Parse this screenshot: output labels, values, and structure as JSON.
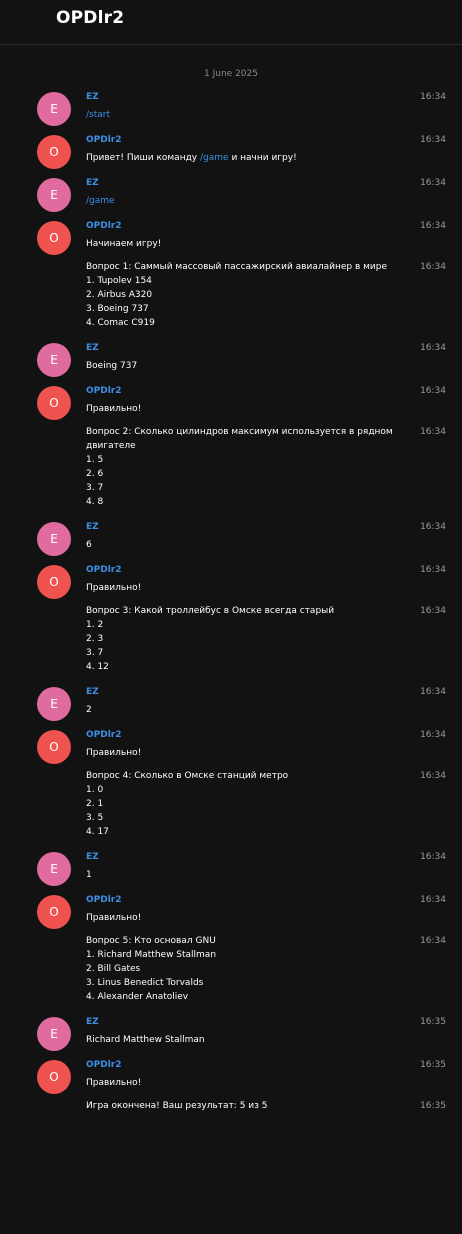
{
  "header": {
    "title": "OPDlr2"
  },
  "date_separator": "1 June 2025",
  "messages": [
    {
      "sender": "EZ",
      "avatar": "E",
      "time": "16:34",
      "lines": [
        {
          "parts": [
            {
              "t": "/start",
              "link": true
            }
          ],
          "time": ""
        }
      ]
    },
    {
      "sender": "OPDlr2",
      "avatar": "O",
      "time": "16:34",
      "lines": [
        {
          "parts": [
            {
              "t": "Привет! Пиши команду "
            },
            {
              "t": "/game",
              "link": true
            },
            {
              "t": " и начни игру!"
            }
          ],
          "time": ""
        }
      ]
    },
    {
      "sender": "EZ",
      "avatar": "E",
      "time": "16:34",
      "lines": [
        {
          "parts": [
            {
              "t": "/game",
              "link": true
            }
          ],
          "time": ""
        }
      ]
    },
    {
      "sender": "OPDlr2",
      "avatar": "O",
      "time": "16:34",
      "lines": [
        {
          "parts": [
            {
              "t": "Начинаем игру!"
            }
          ],
          "time": ""
        },
        {
          "parts": [
            {
              "t": "Вопрос 1: Саммый массовый пассажирский авиалайнер в мире\n1. Tupolev 154\n2. Airbus A320\n3. Boeing 737\n4. Comac C919"
            }
          ],
          "time": "16:34"
        }
      ]
    },
    {
      "sender": "EZ",
      "avatar": "E",
      "time": "16:34",
      "lines": [
        {
          "parts": [
            {
              "t": "Boeing 737"
            }
          ],
          "time": ""
        }
      ]
    },
    {
      "sender": "OPDlr2",
      "avatar": "O",
      "time": "16:34",
      "lines": [
        {
          "parts": [
            {
              "t": "Правильно!"
            }
          ],
          "time": ""
        },
        {
          "parts": [
            {
              "t": "Вопрос 2: Сколько цилиндров максимум используется в рядном двигателе\n1. 5\n2. 6\n3. 7\n4. 8"
            }
          ],
          "time": "16:34"
        }
      ]
    },
    {
      "sender": "EZ",
      "avatar": "E",
      "time": "16:34",
      "lines": [
        {
          "parts": [
            {
              "t": "6"
            }
          ],
          "time": ""
        }
      ]
    },
    {
      "sender": "OPDlr2",
      "avatar": "O",
      "time": "16:34",
      "lines": [
        {
          "parts": [
            {
              "t": "Правильно!"
            }
          ],
          "time": ""
        },
        {
          "parts": [
            {
              "t": "Вопрос 3: Какой троллейбус в Омске всегда старый\n1. 2\n2. 3\n3. 7\n4. 12"
            }
          ],
          "time": "16:34"
        }
      ]
    },
    {
      "sender": "EZ",
      "avatar": "E",
      "time": "16:34",
      "lines": [
        {
          "parts": [
            {
              "t": "2"
            }
          ],
          "time": ""
        }
      ]
    },
    {
      "sender": "OPDlr2",
      "avatar": "O",
      "time": "16:34",
      "lines": [
        {
          "parts": [
            {
              "t": "Правильно!"
            }
          ],
          "time": ""
        },
        {
          "parts": [
            {
              "t": "Вопрос 4: Сколько в Омске станций метро\n1. 0\n2. 1\n3. 5\n4. 17"
            }
          ],
          "time": "16:34"
        }
      ]
    },
    {
      "sender": "EZ",
      "avatar": "E",
      "time": "16:34",
      "lines": [
        {
          "parts": [
            {
              "t": "1"
            }
          ],
          "time": ""
        }
      ]
    },
    {
      "sender": "OPDlr2",
      "avatar": "O",
      "time": "16:34",
      "lines": [
        {
          "parts": [
            {
              "t": "Правильно!"
            }
          ],
          "time": ""
        },
        {
          "parts": [
            {
              "t": "Вопрос 5: Кто основал GNU\n1. Richard Matthew Stallman\n2. Bill Gates\n3. Linus Benedict Torvalds\n4. Alexander Anatoliev"
            }
          ],
          "time": "16:34"
        }
      ]
    },
    {
      "sender": "EZ",
      "avatar": "E",
      "time": "16:35",
      "lines": [
        {
          "parts": [
            {
              "t": "Richard Matthew Stallman"
            }
          ],
          "time": ""
        }
      ]
    },
    {
      "sender": "OPDlr2",
      "avatar": "O",
      "time": "16:35",
      "lines": [
        {
          "parts": [
            {
              "t": "Правильно!"
            }
          ],
          "time": ""
        },
        {
          "parts": [
            {
              "t": "Игра окончена! Ваш результат: 5 из 5"
            }
          ],
          "time": "16:35"
        }
      ]
    }
  ]
}
